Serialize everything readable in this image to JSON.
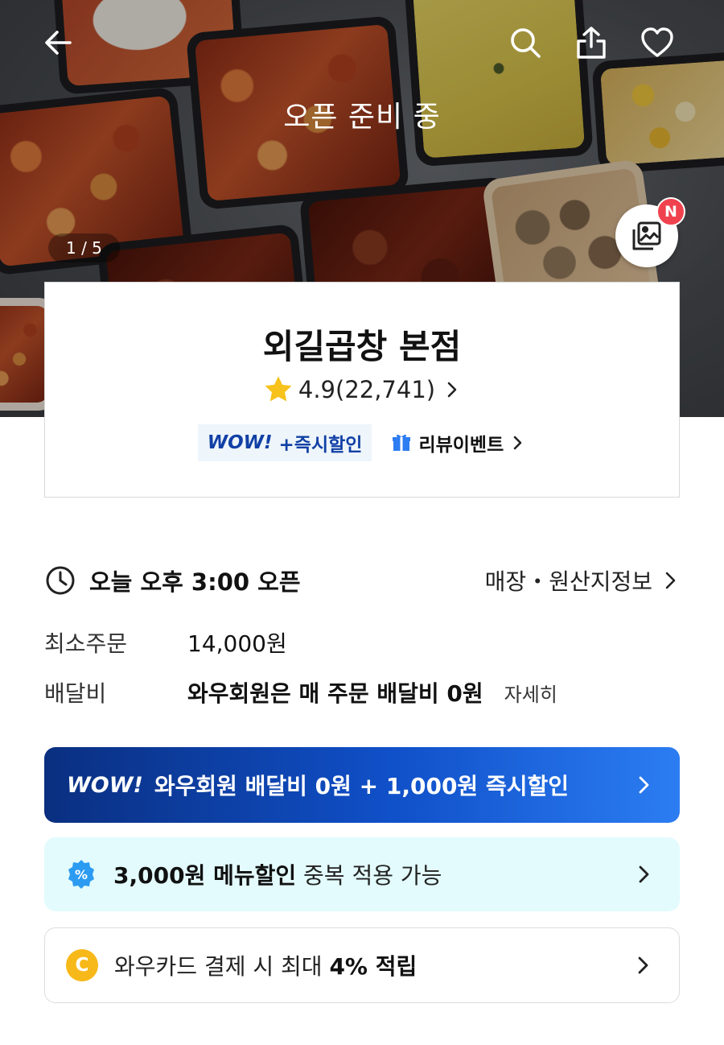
{
  "hero": {
    "status": "오픈 준비 중",
    "page_counter": "1 / 5",
    "new_badge": "N"
  },
  "store": {
    "name": "외길곱창 본점",
    "rating": "4.9",
    "review_count": "(22,741)",
    "wow_logo": "WOW!",
    "wow_pill_text": "+즉시할인",
    "review_event": "리뷰이벤트"
  },
  "info": {
    "open_time": "오늘 오후 3:00 오픈",
    "origin_link": "매장・원산지정보",
    "min_order_label": "최소주문",
    "min_order_value": "14,000원",
    "delivery_fee_label": "배달비",
    "delivery_fee_value": "와우회원은 매 주문 배달비 0원",
    "delivery_fee_detail": "자세히"
  },
  "banners": {
    "wow": {
      "logo": "WOW!",
      "text": "와우회원 배달비 0원 + 1,000원 즉시할인"
    },
    "menu_discount": {
      "bold": "3,000원 메뉴할인",
      "rest": " 중복 적용 가능"
    },
    "wow_card": {
      "prefix": "와우카드 결제 시 최대 ",
      "bold": "4% 적립",
      "coin": "C"
    }
  },
  "colors": {
    "wow_blue": "#1140a5",
    "banner_gradient_start": "#0a2f80",
    "banner_gradient_end": "#2c7df2",
    "star_yellow": "#f7c21c",
    "badge_red": "#f0424e",
    "mint_bg": "#e3fbfd",
    "coin_yellow": "#f7b819"
  }
}
